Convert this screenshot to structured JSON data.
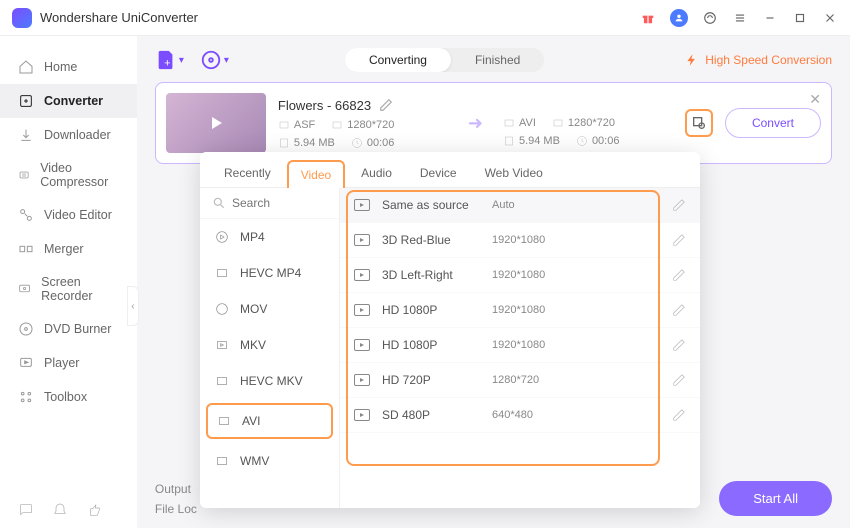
{
  "app": {
    "title": "Wondershare UniConverter",
    "high_speed": "High Speed Conversion"
  },
  "sidebar": {
    "items": [
      {
        "label": "Home"
      },
      {
        "label": "Converter"
      },
      {
        "label": "Downloader"
      },
      {
        "label": "Video Compressor"
      },
      {
        "label": "Video Editor"
      },
      {
        "label": "Merger"
      },
      {
        "label": "Screen Recorder"
      },
      {
        "label": "DVD Burner"
      },
      {
        "label": "Player"
      },
      {
        "label": "Toolbox"
      }
    ]
  },
  "segment": {
    "converting": "Converting",
    "finished": "Finished"
  },
  "file": {
    "name": "Flowers - 66823",
    "src": {
      "format": "ASF",
      "size": "5.94 MB",
      "res": "1280*720",
      "dur": "00:06"
    },
    "dst": {
      "format": "AVI",
      "size": "5.94 MB",
      "res": "1280*720",
      "dur": "00:06"
    },
    "convert": "Convert"
  },
  "dd": {
    "tabs": {
      "recently": "Recently",
      "video": "Video",
      "audio": "Audio",
      "device": "Device",
      "web": "Web Video"
    },
    "search": "Search",
    "formats": [
      {
        "label": "MP4"
      },
      {
        "label": "HEVC MP4"
      },
      {
        "label": "MOV"
      },
      {
        "label": "MKV"
      },
      {
        "label": "HEVC MKV"
      },
      {
        "label": "AVI"
      },
      {
        "label": "WMV"
      }
    ],
    "presets": [
      {
        "name": "Same as source",
        "res": "Auto"
      },
      {
        "name": "3D Red-Blue",
        "res": "1920*1080"
      },
      {
        "name": "3D Left-Right",
        "res": "1920*1080"
      },
      {
        "name": "HD 1080P",
        "res": "1920*1080"
      },
      {
        "name": "HD 1080P",
        "res": "1920*1080"
      },
      {
        "name": "HD 720P",
        "res": "1280*720"
      },
      {
        "name": "SD 480P",
        "res": "640*480"
      }
    ]
  },
  "bottom": {
    "output": "Output",
    "fileloc": "File Loc",
    "start_all": "Start All"
  }
}
